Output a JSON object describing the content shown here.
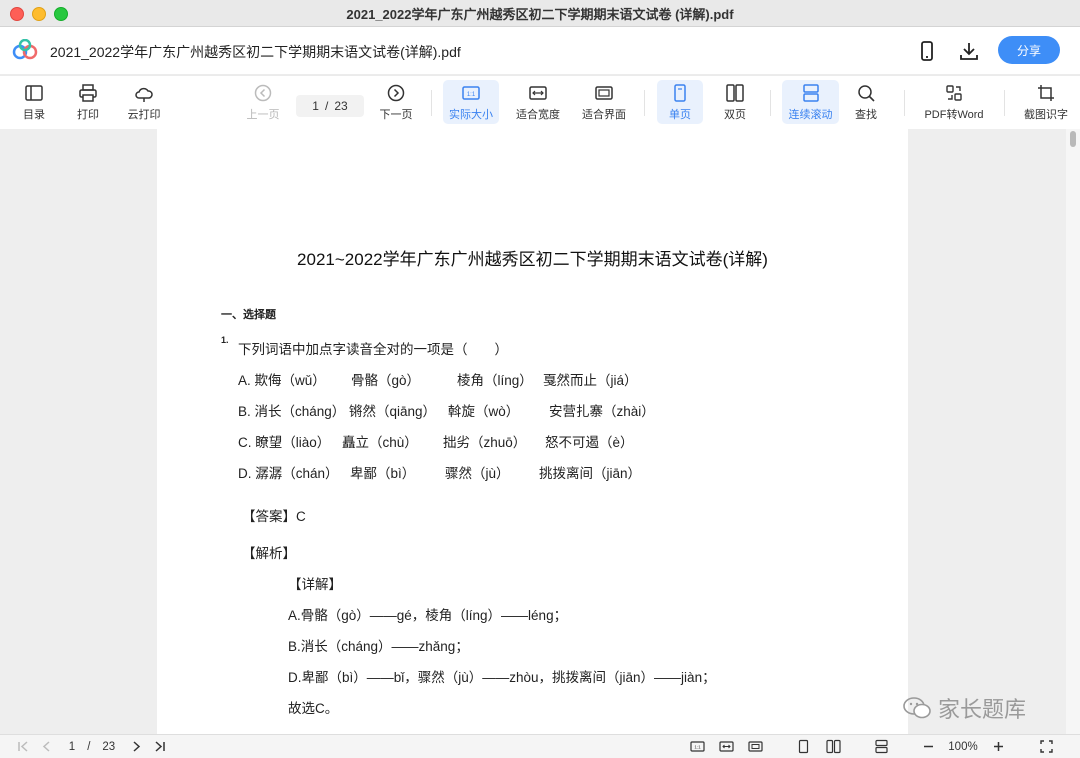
{
  "window": {
    "title": "2021_2022学年广东广州越秀区初二下学期期末语文试卷 (详解).pdf"
  },
  "header": {
    "filename": "2021_2022学年广东广州越秀区初二下学期期末语文试卷(详解).pdf",
    "share_label": "分享"
  },
  "toolbar": {
    "toc": "目录",
    "print": "打印",
    "cloud_print": "云打印",
    "prev": "上一页",
    "page_current": "1",
    "page_sep": "/",
    "page_total": "23",
    "next": "下一页",
    "actual_size": "实际大小",
    "fit_width": "适合宽度",
    "fit_page": "适合界面",
    "single": "单页",
    "double": "双页",
    "continuous": "连续滚动",
    "find": "查找",
    "pdf_word": "PDF转Word",
    "ocr": "截图识字"
  },
  "document": {
    "title": "2021~2022学年广东广州越秀区初二下学期期末语文试卷(详解)",
    "section": "一、选择题",
    "qnum": "1.",
    "question": "下列词语中加点字读音全对的一项是（　　）",
    "options": [
      [
        "A. 欺侮（wǔ）",
        "骨骼（gò）",
        "棱角（líng）",
        "戛然而止（jiá）"
      ],
      [
        "B. 消长（cháng）",
        "锵然（qiāng）",
        "斡旋（wò）",
        "安营扎寨（zhài）"
      ],
      [
        "C. 瞭望（liào）",
        "矗立（chù）",
        "拙劣（zhuō）",
        "怒不可遏（è）"
      ],
      [
        "D. 潺潺（chán）",
        "卑鄙（bì）",
        "骤然（jù）",
        "挑拨离间（jiān）"
      ]
    ],
    "answer_label": "【答案】",
    "answer_value": "C",
    "analysis_label": "【解析】",
    "detail_label": "【详解】",
    "details": [
      "A.骨骼（gò）——gé，棱角（líng）——léng；",
      "B.消长（cháng）——zhǎng；",
      "D.卑鄙（bì）——bǐ，骤然（jù）——zhòu，挑拨离间（jiān）——jiàn；",
      "故选C。"
    ]
  },
  "watermark": {
    "text": "家长题库"
  },
  "statusbar": {
    "page_current": "1",
    "page_sep": "/",
    "page_total": "23",
    "zoom": "100%"
  }
}
